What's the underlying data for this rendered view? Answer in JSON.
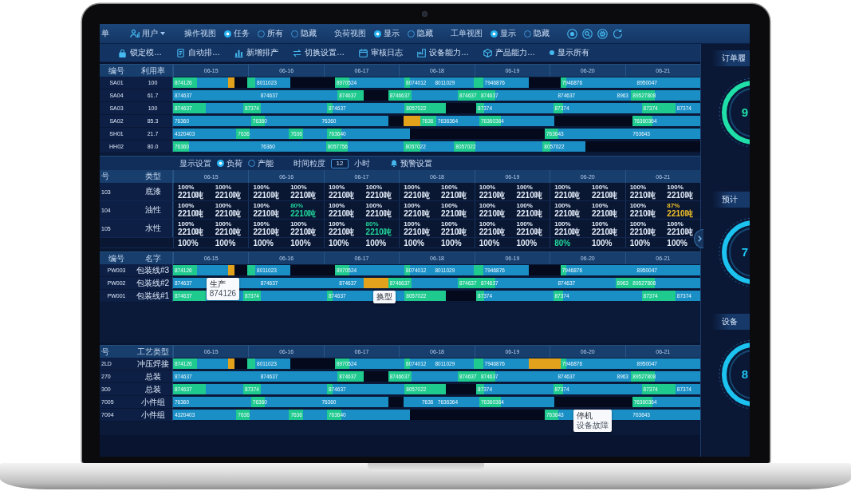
{
  "toolbar": {
    "lead_text": "单",
    "user": "用户",
    "groups": [
      {
        "label": "操作视图",
        "options": [
          {
            "label": "任务",
            "selected": true
          },
          {
            "label": "所有",
            "selected": false
          },
          {
            "label": "隐藏",
            "selected": false
          }
        ]
      },
      {
        "label": "负荷视图",
        "options": [
          {
            "label": "显示",
            "selected": true
          },
          {
            "label": "隐藏",
            "selected": false
          }
        ]
      },
      {
        "label": "工单视图",
        "options": [
          {
            "label": "显示",
            "selected": true
          },
          {
            "label": "隐藏",
            "selected": false
          }
        ]
      }
    ]
  },
  "actions": [
    "锁定模…",
    "自动排…",
    "新增排产",
    "切换设置…",
    "审核日志",
    "设备能力…",
    "产品能力…",
    "显示所有"
  ],
  "machine_schedule": {
    "columns": [
      "编号",
      "利用率"
    ],
    "dates": [
      "06-15",
      "06-16",
      "06-17",
      "06-18",
      "06-19",
      "06-20",
      "06-21"
    ],
    "rows": [
      {
        "values": [
          "SA01",
          "100"
        ],
        "segments": [
          {
            "kind": "setup",
            "label": "874126"
          },
          {
            "kind": "run"
          },
          {
            "kind": "alert"
          },
          {
            "kind": "idle"
          },
          {
            "kind": "setup"
          },
          {
            "kind": "run",
            "label": "8011023"
          },
          {
            "kind": "idle"
          },
          {
            "kind": "setup",
            "label": "8970524"
          },
          {
            "kind": "run"
          },
          {
            "kind": "setup",
            "label": "8074012"
          },
          {
            "kind": "run"
          },
          {
            "kind": "run",
            "label": "8011029"
          },
          {
            "kind": "setup"
          },
          {
            "kind": "run",
            "label": "7946876"
          },
          {
            "kind": "idle"
          },
          {
            "kind": "setup",
            "label": "7946876"
          },
          {
            "kind": "run"
          },
          {
            "kind": "run",
            "label": "8950047"
          }
        ]
      },
      {
        "values": [
          "SA04",
          "61.7"
        ],
        "segments": [
          {
            "kind": "run",
            "label": "874637"
          },
          {
            "kind": "run",
            "label": "874637"
          },
          {
            "kind": "setup",
            "label": "874637"
          },
          {
            "kind": "idle"
          },
          {
            "kind": "setup",
            "label": "8746637"
          },
          {
            "kind": "run"
          },
          {
            "kind": "setup",
            "label": "874637"
          },
          {
            "kind": "setup",
            "label": "874637"
          },
          {
            "kind": "run"
          },
          {
            "kind": "run",
            "label": "874637"
          },
          {
            "kind": "run",
            "label": "8963"
          },
          {
            "kind": "setup",
            "label": "89527808"
          },
          {
            "kind": "run"
          }
        ]
      },
      {
        "values": [
          "SA03",
          "100"
        ],
        "segments": [
          {
            "kind": "setup",
            "label": "874637"
          },
          {
            "kind": "run"
          },
          {
            "kind": "setup",
            "label": "87374"
          },
          {
            "kind": "run"
          },
          {
            "kind": "setup",
            "label": "874637"
          },
          {
            "kind": "run"
          },
          {
            "kind": "setup",
            "label": "8057022"
          },
          {
            "kind": "idle"
          },
          {
            "kind": "setup",
            "label": "87374"
          },
          {
            "kind": "run"
          },
          {
            "kind": "setup",
            "label": "87374"
          },
          {
            "kind": "run"
          },
          {
            "kind": "setup",
            "label": "87374"
          },
          {
            "kind": "run",
            "label": "87374"
          }
        ]
      },
      {
        "values": [
          "SA02",
          "85.3"
        ],
        "segments": [
          {
            "kind": "run",
            "label": "76360"
          },
          {
            "kind": "setup",
            "label": "76360"
          },
          {
            "kind": "run"
          },
          {
            "kind": "run",
            "label": "76360"
          },
          {
            "kind": "idle"
          },
          {
            "kind": "alert"
          },
          {
            "kind": "setup",
            "label": "7636"
          },
          {
            "kind": "run",
            "label": "7636364"
          },
          {
            "kind": "setup",
            "label": "76360364"
          },
          {
            "kind": "run"
          },
          {
            "kind": "idle"
          },
          {
            "kind": "setup",
            "label": "76360364"
          },
          {
            "kind": "run"
          }
        ]
      },
      {
        "values": [
          "SH01",
          "21.7"
        ],
        "segments": [
          {
            "kind": "run",
            "label": "4320403"
          },
          {
            "kind": "setup",
            "label": "7636"
          },
          {
            "kind": "run"
          },
          {
            "kind": "setup",
            "label": "7636"
          },
          {
            "kind": "run"
          },
          {
            "kind": "setup",
            "label": "763640"
          },
          {
            "kind": "run"
          },
          {
            "kind": "idle"
          },
          {
            "kind": "setup",
            "label": "763643"
          },
          {
            "kind": "run"
          },
          {
            "kind": "run",
            "label": "763643"
          }
        ]
      },
      {
        "values": [
          "HH02",
          "80.0"
        ],
        "segments": [
          {
            "kind": "setup",
            "label": "76360"
          },
          {
            "kind": "run"
          },
          {
            "kind": "run",
            "label": "76360"
          },
          {
            "kind": "setup",
            "label": "8057756"
          },
          {
            "kind": "run"
          },
          {
            "kind": "setup",
            "label": "8057022"
          },
          {
            "kind": "run"
          },
          {
            "kind": "setup",
            "label": "8057022"
          },
          {
            "kind": "run"
          },
          {
            "kind": "setup",
            "label": "8057022"
          },
          {
            "kind": "run"
          },
          {
            "kind": "idle"
          }
        ]
      }
    ]
  },
  "load_table": {
    "settings": {
      "label": "显示设置",
      "options": [
        {
          "label": "负荷",
          "selected": true
        },
        {
          "label": "产能",
          "selected": false
        }
      ],
      "granularity_label": "时间粒度",
      "granularity": "12",
      "unit": "小时",
      "alert_settings": "预警设置"
    },
    "columns": [
      "号",
      "类型"
    ],
    "dates": [
      "06-15",
      "06-16",
      "06-17",
      "06-18",
      "06-19",
      "06-20",
      "06-21"
    ],
    "rows": [
      {
        "values": [
          "103",
          "底漆"
        ],
        "cells": [
          {
            "percent": "100%",
            "amount": "2210吨",
            "color": "#e3ecf9"
          },
          {
            "percent": "100%",
            "amount": "2210吨",
            "color": "#e3ecf9"
          },
          {
            "percent": "100%",
            "amount": "2210吨",
            "color": "#e3ecf9"
          },
          {
            "percent": "100%",
            "amount": "2210吨",
            "color": "#e3ecf9"
          },
          {
            "percent": "100%",
            "amount": "2210吨",
            "color": "#e3ecf9"
          },
          {
            "percent": "100%",
            "amount": "2210吨",
            "color": "#e3ecf9"
          },
          {
            "percent": "100%",
            "amount": "2210吨",
            "color": "#e3ecf9"
          },
          {
            "percent": "100%",
            "amount": "2210吨",
            "color": "#e3ecf9"
          },
          {
            "percent": "100%",
            "amount": "2210吨",
            "color": "#e3ecf9"
          },
          {
            "percent": "100%",
            "amount": "2210吨",
            "color": "#e3ecf9"
          },
          {
            "percent": "100%",
            "amount": "2210吨",
            "color": "#e3ecf9"
          },
          {
            "percent": "100%",
            "amount": "2210吨",
            "color": "#e3ecf9"
          },
          {
            "percent": "100%",
            "amount": "2210吨",
            "color": "#e3ecf9"
          },
          {
            "percent": "100%",
            "amount": "2210吨",
            "color": "#e3ecf9"
          }
        ]
      },
      {
        "values": [
          "104",
          "油性"
        ],
        "cells": [
          {
            "percent": "100%",
            "amount": "2210吨",
            "color": "#e3ecf9"
          },
          {
            "percent": "100%",
            "amount": "2210吨",
            "color": "#e3ecf9"
          },
          {
            "percent": "100%",
            "amount": "2210吨",
            "color": "#e3ecf9"
          },
          {
            "percent": "80%",
            "amount": "2210吨",
            "color": "#22d39a"
          },
          {
            "percent": "100%",
            "amount": "2210吨",
            "color": "#e3ecf9"
          },
          {
            "percent": "100%",
            "amount": "2210吨",
            "color": "#e3ecf9"
          },
          {
            "percent": "100%",
            "amount": "2210吨",
            "color": "#e3ecf9"
          },
          {
            "percent": "100%",
            "amount": "2210吨",
            "color": "#e3ecf9"
          },
          {
            "percent": "100%",
            "amount": "2210吨",
            "color": "#e3ecf9"
          },
          {
            "percent": "100%",
            "amount": "2210吨",
            "color": "#e3ecf9"
          },
          {
            "percent": "100%",
            "amount": "2210吨",
            "color": "#e3ecf9"
          },
          {
            "percent": "100%",
            "amount": "2210吨",
            "color": "#e3ecf9"
          },
          {
            "percent": "100%",
            "amount": "2210吨",
            "color": "#e3ecf9"
          },
          {
            "percent": "87%",
            "amount": "2210吨",
            "color": "#f2c02a"
          }
        ]
      },
      {
        "values": [
          "105",
          "水性"
        ],
        "cells": [
          {
            "percent": "100%",
            "amount": "2210吨",
            "color": "#e3ecf9"
          },
          {
            "percent": "100%",
            "amount": "2210吨",
            "color": "#e3ecf9"
          },
          {
            "percent": "100%",
            "amount": "2210吨",
            "color": "#e3ecf9"
          },
          {
            "percent": "100%",
            "amount": "2210吨",
            "color": "#e3ecf9"
          },
          {
            "percent": "100%",
            "amount": "2210吨",
            "color": "#e3ecf9"
          },
          {
            "percent": "80%",
            "amount": "2210吨",
            "color": "#22d39a"
          },
          {
            "percent": "100%",
            "amount": "2210吨",
            "color": "#e3ecf9"
          },
          {
            "percent": "100%",
            "amount": "2210吨",
            "color": "#e3ecf9"
          },
          {
            "percent": "100%",
            "amount": "2210吨",
            "color": "#e3ecf9"
          },
          {
            "percent": "100%",
            "amount": "2210吨",
            "color": "#e3ecf9"
          },
          {
            "percent": "100%",
            "amount": "2210吨",
            "color": "#e3ecf9"
          },
          {
            "percent": "100%",
            "amount": "2210吨",
            "color": "#e3ecf9"
          },
          {
            "percent": "100%",
            "amount": "2210吨",
            "color": "#e3ecf9"
          },
          {
            "percent": "100%",
            "amount": "2210吨",
            "color": "#e3ecf9"
          }
        ]
      },
      {
        "cells": [
          {
            "percent": "100%",
            "color": "#e3ecf9"
          },
          {
            "percent": "100%",
            "color": "#e3ecf9"
          },
          {
            "percent": "100%",
            "color": "#e3ecf9"
          },
          {
            "percent": "100%",
            "color": "#e3ecf9"
          },
          {
            "percent": "100%",
            "color": "#e3ecf9"
          },
          {
            "percent": "100%",
            "color": "#e3ecf9"
          },
          {
            "percent": "100%",
            "color": "#e3ecf9"
          },
          {
            "percent": "100%",
            "color": "#e3ecf9"
          },
          {
            "percent": "100%",
            "color": "#e3ecf9"
          },
          {
            "percent": "100%",
            "color": "#e3ecf9"
          },
          {
            "percent": "80%",
            "color": "#22d39a"
          },
          {
            "percent": "100%",
            "color": "#e3ecf9"
          },
          {
            "percent": "100%",
            "color": "#e3ecf9"
          },
          {
            "percent": "100%",
            "color": "#e3ecf9"
          }
        ]
      }
    ]
  },
  "line_schedule": {
    "columns": [
      "编号",
      "名字"
    ],
    "dates": [
      "06-15",
      "06-16",
      "06-17",
      "06-18",
      "06-19",
      "06-20",
      "06-21"
    ],
    "rows": [
      {
        "values": [
          "PW003",
          "包装线#3"
        ],
        "segments": [
          {
            "kind": "setup",
            "label": "874126"
          },
          {
            "kind": "run",
            "tooltip": {
              "title": "生产",
              "detail": "874126"
            }
          },
          {
            "kind": "alert"
          },
          {
            "kind": "idle"
          },
          {
            "kind": "setup"
          },
          {
            "kind": "run",
            "label": "8011023"
          },
          {
            "kind": "idle"
          },
          {
            "kind": "setup",
            "label": "8970524"
          },
          {
            "kind": "run"
          },
          {
            "kind": "setup",
            "label": "8074012"
          },
          {
            "kind": "run"
          },
          {
            "kind": "run",
            "label": "8011029"
          },
          {
            "kind": "setup"
          },
          {
            "kind": "run",
            "label": "7946876"
          },
          {
            "kind": "idle"
          },
          {
            "kind": "setup",
            "label": "7946876"
          },
          {
            "kind": "run"
          },
          {
            "kind": "run",
            "label": "8950047"
          }
        ]
      },
      {
        "values": [
          "PW002",
          "包装线#2"
        ],
        "segments": [
          {
            "kind": "run",
            "label": "874637"
          },
          {
            "kind": "run",
            "label": "874637"
          },
          {
            "kind": "run",
            "label": "874637"
          },
          {
            "kind": "alert",
            "tooltip": {
              "title": "换型"
            }
          },
          {
            "kind": "setup",
            "label": "8746637"
          },
          {
            "kind": "run"
          },
          {
            "kind": "setup",
            "label": "874637"
          },
          {
            "kind": "setup",
            "label": "874637"
          },
          {
            "kind": "run"
          },
          {
            "kind": "run",
            "label": "874637"
          },
          {
            "kind": "setup",
            "label": "8963"
          },
          {
            "kind": "setup",
            "label": "89527808"
          },
          {
            "kind": "run"
          }
        ]
      },
      {
        "values": [
          "PW001",
          "包装线#1"
        ],
        "segments": [
          {
            "kind": "setup",
            "label": "874637"
          },
          {
            "kind": "run"
          },
          {
            "kind": "setup",
            "label": "87374"
          },
          {
            "kind": "run"
          },
          {
            "kind": "setup",
            "label": "874637"
          },
          {
            "kind": "run"
          },
          {
            "kind": "setup",
            "label": "8057022"
          },
          {
            "kind": "idle"
          },
          {
            "kind": "setup",
            "label": "87374"
          },
          {
            "kind": "run"
          },
          {
            "kind": "setup",
            "label": "87374"
          },
          {
            "kind": "run"
          },
          {
            "kind": "setup",
            "label": "87374"
          },
          {
            "kind": "run",
            "label": "87374"
          }
        ]
      }
    ]
  },
  "process_schedule": {
    "columns": [
      "号",
      "工艺类型"
    ],
    "dates": [
      "06-15",
      "06-16",
      "06-17",
      "06-18",
      "06-19",
      "06-20",
      "06-21"
    ],
    "rows": [
      {
        "values": [
          "2LD",
          "冲压焊接"
        ],
        "segments": [
          {
            "kind": "setup",
            "label": "874126"
          },
          {
            "kind": "run"
          },
          {
            "kind": "alert"
          },
          {
            "kind": "idle"
          },
          {
            "kind": "setup"
          },
          {
            "kind": "run",
            "label": "8011023"
          },
          {
            "kind": "idle"
          },
          {
            "kind": "setup",
            "label": "8970524"
          },
          {
            "kind": "run"
          },
          {
            "kind": "setup",
            "label": "8074012"
          },
          {
            "kind": "run"
          },
          {
            "kind": "run",
            "label": "8011029"
          },
          {
            "kind": "setup"
          },
          {
            "kind": "run",
            "label": "7946876"
          },
          {
            "kind": "alert"
          },
          {
            "kind": "setup",
            "label": "7946876"
          },
          {
            "kind": "run"
          },
          {
            "kind": "run",
            "label": "8950047"
          }
        ]
      },
      {
        "values": [
          "270",
          "总装"
        ],
        "segments": [
          {
            "kind": "run",
            "label": "874637"
          },
          {
            "kind": "run",
            "label": "874637"
          },
          {
            "kind": "setup",
            "label": "874637"
          },
          {
            "kind": "idle"
          },
          {
            "kind": "setup",
            "label": "8746637"
          },
          {
            "kind": "run"
          },
          {
            "kind": "setup",
            "label": "874637"
          },
          {
            "kind": "setup",
            "label": "874637"
          },
          {
            "kind": "run"
          },
          {
            "kind": "run",
            "label": "874637"
          },
          {
            "kind": "run",
            "label": "8963"
          },
          {
            "kind": "setup",
            "label": "89527808"
          },
          {
            "kind": "run"
          }
        ]
      },
      {
        "values": [
          "300",
          "总装"
        ],
        "segments": [
          {
            "kind": "setup",
            "label": "874637"
          },
          {
            "kind": "run"
          },
          {
            "kind": "setup",
            "label": "87374"
          },
          {
            "kind": "run"
          },
          {
            "kind": "setup",
            "label": "874637"
          },
          {
            "kind": "run"
          },
          {
            "kind": "setup",
            "label": "8057022"
          },
          {
            "kind": "idle"
          },
          {
            "kind": "setup",
            "label": "87374"
          },
          {
            "kind": "run"
          },
          {
            "kind": "setup",
            "label": "87374"
          },
          {
            "kind": "run"
          },
          {
            "kind": "setup",
            "label": "87374"
          },
          {
            "kind": "run",
            "label": "87374"
          }
        ]
      },
      {
        "values": [
          "7005",
          "小件组"
        ],
        "segments": [
          {
            "kind": "run",
            "label": "76360"
          },
          {
            "kind": "setup",
            "label": "76360"
          },
          {
            "kind": "run"
          },
          {
            "kind": "run",
            "label": "76360"
          },
          {
            "kind": "idle"
          },
          {
            "kind": "run"
          },
          {
            "kind": "run",
            "label": "7636"
          },
          {
            "kind": "run",
            "label": "7636364"
          },
          {
            "kind": "setup",
            "label": "76360364"
          },
          {
            "kind": "run"
          },
          {
            "kind": "idle",
            "tooltip": {
              "title": "停机",
              "detail": "设备故障"
            }
          },
          {
            "kind": "setup",
            "label": "76360364"
          },
          {
            "kind": "run"
          }
        ]
      },
      {
        "values": [
          "7004",
          "小件组"
        ],
        "segments": [
          {
            "kind": "run",
            "label": "4320403"
          },
          {
            "kind": "setup",
            "label": "7636"
          },
          {
            "kind": "run"
          },
          {
            "kind": "setup",
            "label": "7636"
          },
          {
            "kind": "run"
          },
          {
            "kind": "setup",
            "label": "763640"
          },
          {
            "kind": "run"
          },
          {
            "kind": "idle"
          },
          {
            "kind": "setup",
            "label": "763643"
          },
          {
            "kind": "run"
          },
          {
            "kind": "run",
            "label": "763643"
          }
        ]
      }
    ]
  },
  "side_panel": {
    "gauges": [
      {
        "title": "订单履",
        "value": "9",
        "color": "#1fe0a8"
      },
      {
        "title": "预计",
        "value": "7",
        "color": "#1cc3f0"
      },
      {
        "title": "设备",
        "value": "8",
        "color": "#1cc3f0"
      }
    ]
  }
}
